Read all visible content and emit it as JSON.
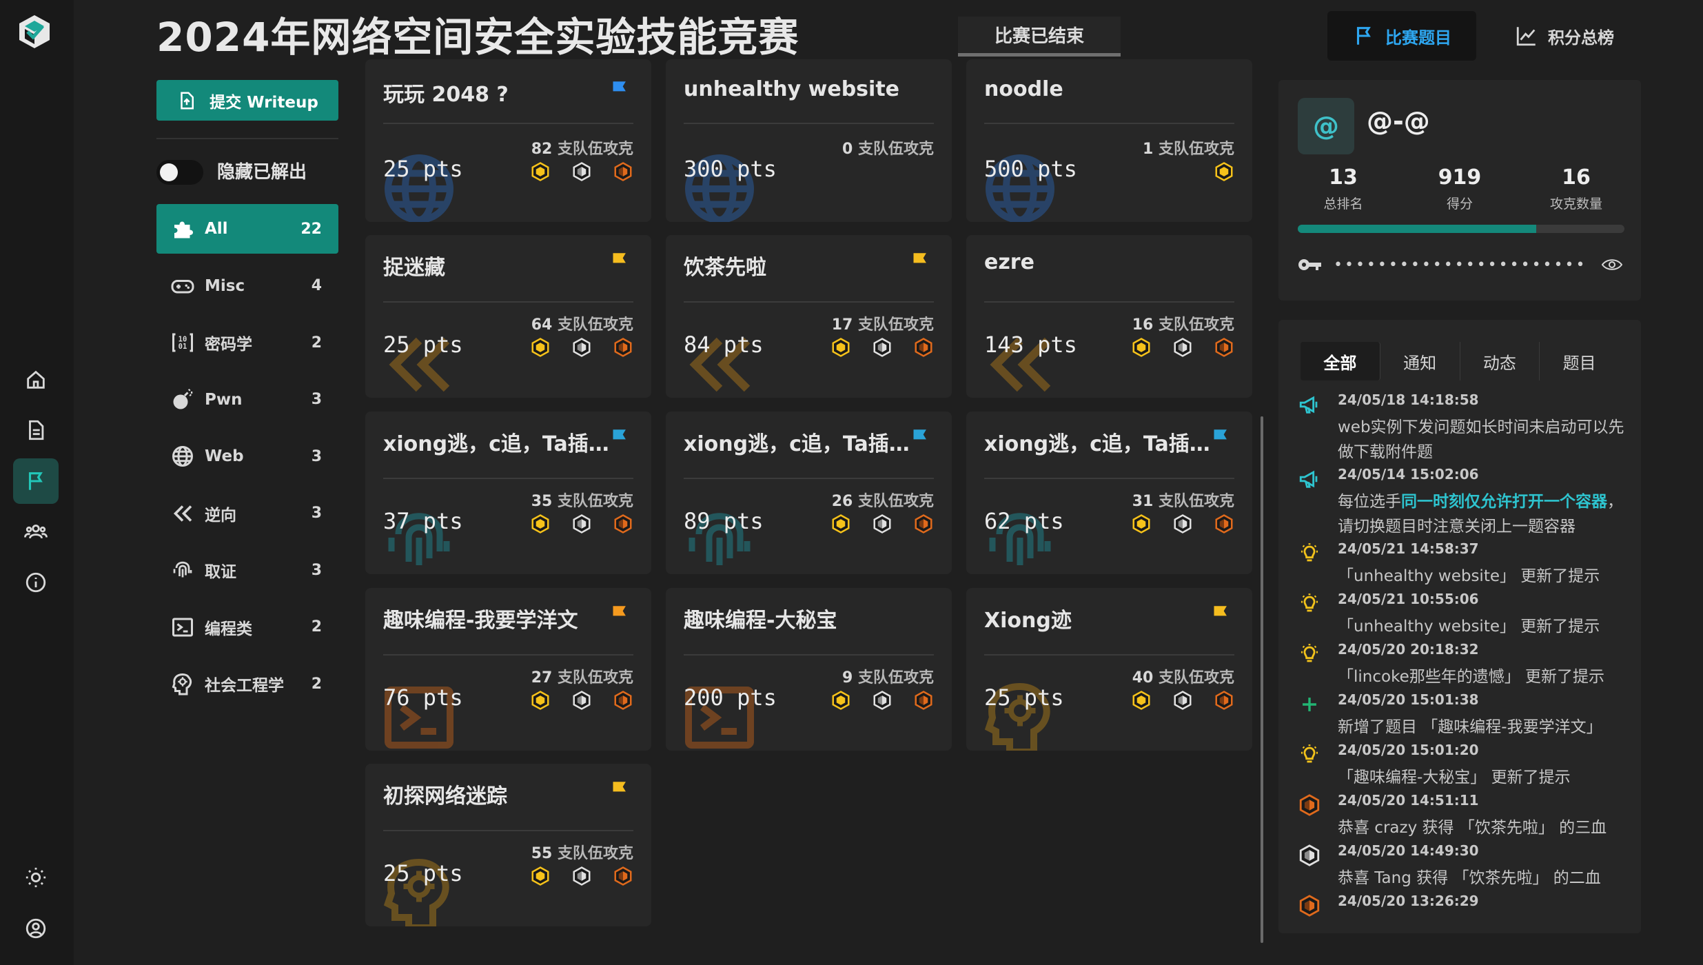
{
  "header": {
    "title": "2024年网络空间安全实验技能竞赛",
    "status": "比赛已结束",
    "nav_challenges": "比赛题目",
    "nav_scoreboard": "积分总榜"
  },
  "sidebar": {
    "writeup_label": "提交 Writeup",
    "hide_solved_label": "隐藏已解出",
    "hide_solved_on": false,
    "categories": [
      {
        "name": "All",
        "count": "22",
        "icon": "puzzle-icon"
      },
      {
        "name": "Misc",
        "count": "4",
        "icon": "gamepad-icon"
      },
      {
        "name": "密码学",
        "count": "2",
        "icon": "binary-icon"
      },
      {
        "name": "Pwn",
        "count": "3",
        "icon": "bomb-icon"
      },
      {
        "name": "Web",
        "count": "3",
        "icon": "globe-icon"
      },
      {
        "name": "逆向",
        "count": "3",
        "icon": "rewind-icon"
      },
      {
        "name": "取证",
        "count": "3",
        "icon": "fingerprint-icon"
      },
      {
        "name": "编程类",
        "count": "2",
        "icon": "terminal-icon"
      },
      {
        "name": "社会工程学",
        "count": "2",
        "icon": "brain-icon"
      }
    ]
  },
  "solves_suffix": "支队伍攻克",
  "challenges": [
    {
      "title": "玩玩 2048 ?",
      "points": "25 pts",
      "solves": "82",
      "flag_color": "#2e8ef0",
      "icon": "globe-icon"
    },
    {
      "title": "unhealthy website",
      "points": "300 pts",
      "solves": "0",
      "flag_color": "",
      "icon": "globe-icon"
    },
    {
      "title": "noodle",
      "points": "500 pts",
      "solves": "1",
      "flag_color": "",
      "icon": "globe-icon"
    },
    {
      "title": "捉迷藏",
      "points": "25 pts",
      "solves": "64",
      "flag_color": "#f5bd1f",
      "icon": "rewind-icon"
    },
    {
      "title": "饮茶先啦",
      "points": "84 pts",
      "solves": "17",
      "flag_color": "#f5bd1f",
      "icon": "rewind-icon"
    },
    {
      "title": "ezre",
      "points": "143 pts",
      "solves": "16",
      "flag_color": "",
      "icon": "rewind-icon"
    },
    {
      "title": "xiong逃，c追，Ta插...",
      "points": "37 pts",
      "solves": "35",
      "flag_color": "#2aa3d8",
      "icon": "fingerprint-icon"
    },
    {
      "title": "xiong逃，c追，Ta插...",
      "points": "89 pts",
      "solves": "26",
      "flag_color": "#2aa3d8",
      "icon": "fingerprint-icon"
    },
    {
      "title": "xiong逃，c追，Ta插...",
      "points": "62 pts",
      "solves": "31",
      "flag_color": "#2aa3d8",
      "icon": "fingerprint-icon"
    },
    {
      "title": "趣味编程-我要学洋文",
      "points": "76 pts",
      "solves": "27",
      "flag_color": "#f59a1f",
      "icon": "terminal-icon"
    },
    {
      "title": "趣味编程-大秘宝",
      "points": "200 pts",
      "solves": "9",
      "flag_color": "",
      "icon": "terminal-icon"
    },
    {
      "title": "Xiong迹",
      "points": "25 pts",
      "solves": "40",
      "flag_color": "#f5bd1f",
      "icon": "brain-icon"
    },
    {
      "title": "初探网络迷踪",
      "points": "25 pts",
      "solves": "55",
      "flag_color": "#f5bd1f",
      "icon": "brain-icon"
    }
  ],
  "profile": {
    "avatar": "@",
    "name": "@-@",
    "rank": "13",
    "rank_label": "总排名",
    "score": "919",
    "score_label": "得分",
    "solved": "16",
    "solved_label": "攻克数量",
    "progress_fraction": 0.73,
    "token_mask": "••••••••••••••••••••••••"
  },
  "notices": {
    "tabs": [
      "全部",
      "通知",
      "动态",
      "题目"
    ],
    "items": [
      {
        "icon": "megaphone-icon",
        "time": "24/05/18 14:18:58",
        "pre": "web实例下发问题如长时间未启动可以先做下载附件题",
        "hl": "",
        "post": ""
      },
      {
        "icon": "megaphone-icon",
        "time": "24/05/14 15:02:06",
        "pre": "每位选手",
        "hl": "同一时刻仅允许打开一个容器",
        "post": "，请切换题目时注意关闭上一题容器"
      },
      {
        "icon": "bulb-icon",
        "time": "24/05/21 14:58:37",
        "pre": "「unhealthy website」 更新了提示",
        "hl": "",
        "post": ""
      },
      {
        "icon": "bulb-icon",
        "time": "24/05/21 10:55:06",
        "pre": "「unhealthy website」 更新了提示",
        "hl": "",
        "post": ""
      },
      {
        "icon": "bulb-icon",
        "time": "24/05/20 20:18:32",
        "pre": "「lincoke那些年的遗憾」 更新了提示",
        "hl": "",
        "post": ""
      },
      {
        "icon": "plus-icon",
        "time": "24/05/20 15:01:38",
        "pre": "新增了题目 「趣味编程-我要学洋文」",
        "hl": "",
        "post": ""
      },
      {
        "icon": "bulb-icon",
        "time": "24/05/20 15:01:20",
        "pre": "「趣味编程-大秘宝」 更新了提示",
        "hl": "",
        "post": ""
      },
      {
        "icon": "bronze-blood-icon",
        "time": "24/05/20 14:51:11",
        "pre": "恭喜 crazy 获得 「饮茶先啦」 的三血",
        "hl": "",
        "post": ""
      },
      {
        "icon": "silver-blood-icon",
        "time": "24/05/20 14:49:30",
        "pre": "恭喜 Tang 获得 「饮茶先啦」 的二血",
        "hl": "",
        "post": ""
      },
      {
        "icon": "bronze-blood-icon",
        "time": "24/05/20 13:26:29",
        "pre": "",
        "hl": "",
        "post": ""
      }
    ]
  }
}
